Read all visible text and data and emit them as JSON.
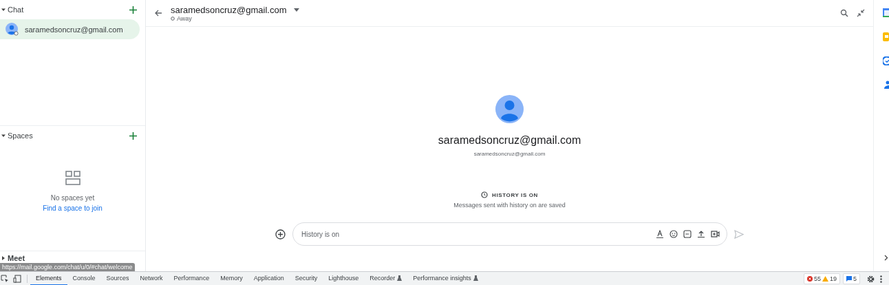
{
  "sidebar": {
    "sections": [
      {
        "title": "Chat",
        "expanded": true,
        "items": [
          {
            "label": "saramedsoncruz@gmail.com",
            "selected": true
          }
        ]
      },
      {
        "title": "Spaces",
        "expanded": true,
        "empty_text": "No spaces yet",
        "link": "Find a space to join"
      },
      {
        "title": "Meet",
        "expanded": false
      }
    ]
  },
  "status_url": "https://mail.google.com/chat/u/0/#chat/welcome",
  "header": {
    "title": "saramedsoncruz@gmail.com",
    "status": "Away"
  },
  "profile": {
    "name": "saramedsoncruz@gmail.com",
    "email": "saramedsoncruz@gmail.com"
  },
  "history": {
    "title": "HISTORY IS ON",
    "subtitle": "Messages sent with history on are saved"
  },
  "composer": {
    "placeholder": "History is on"
  },
  "devtools": {
    "tabs": [
      {
        "label": "Elements",
        "selected": true
      },
      {
        "label": "Console",
        "selected": false
      },
      {
        "label": "Sources",
        "selected": false
      },
      {
        "label": "Network",
        "selected": false
      },
      {
        "label": "Performance",
        "selected": false
      },
      {
        "label": "Memory",
        "selected": false
      },
      {
        "label": "Application",
        "selected": false
      },
      {
        "label": "Security",
        "selected": false
      },
      {
        "label": "Lighthouse",
        "selected": false
      },
      {
        "label": "Recorder",
        "selected": false,
        "experimental": true
      },
      {
        "label": "Performance insights",
        "selected": false,
        "experimental": true
      }
    ],
    "errors": "55",
    "warnings": "19",
    "messages": "5"
  }
}
